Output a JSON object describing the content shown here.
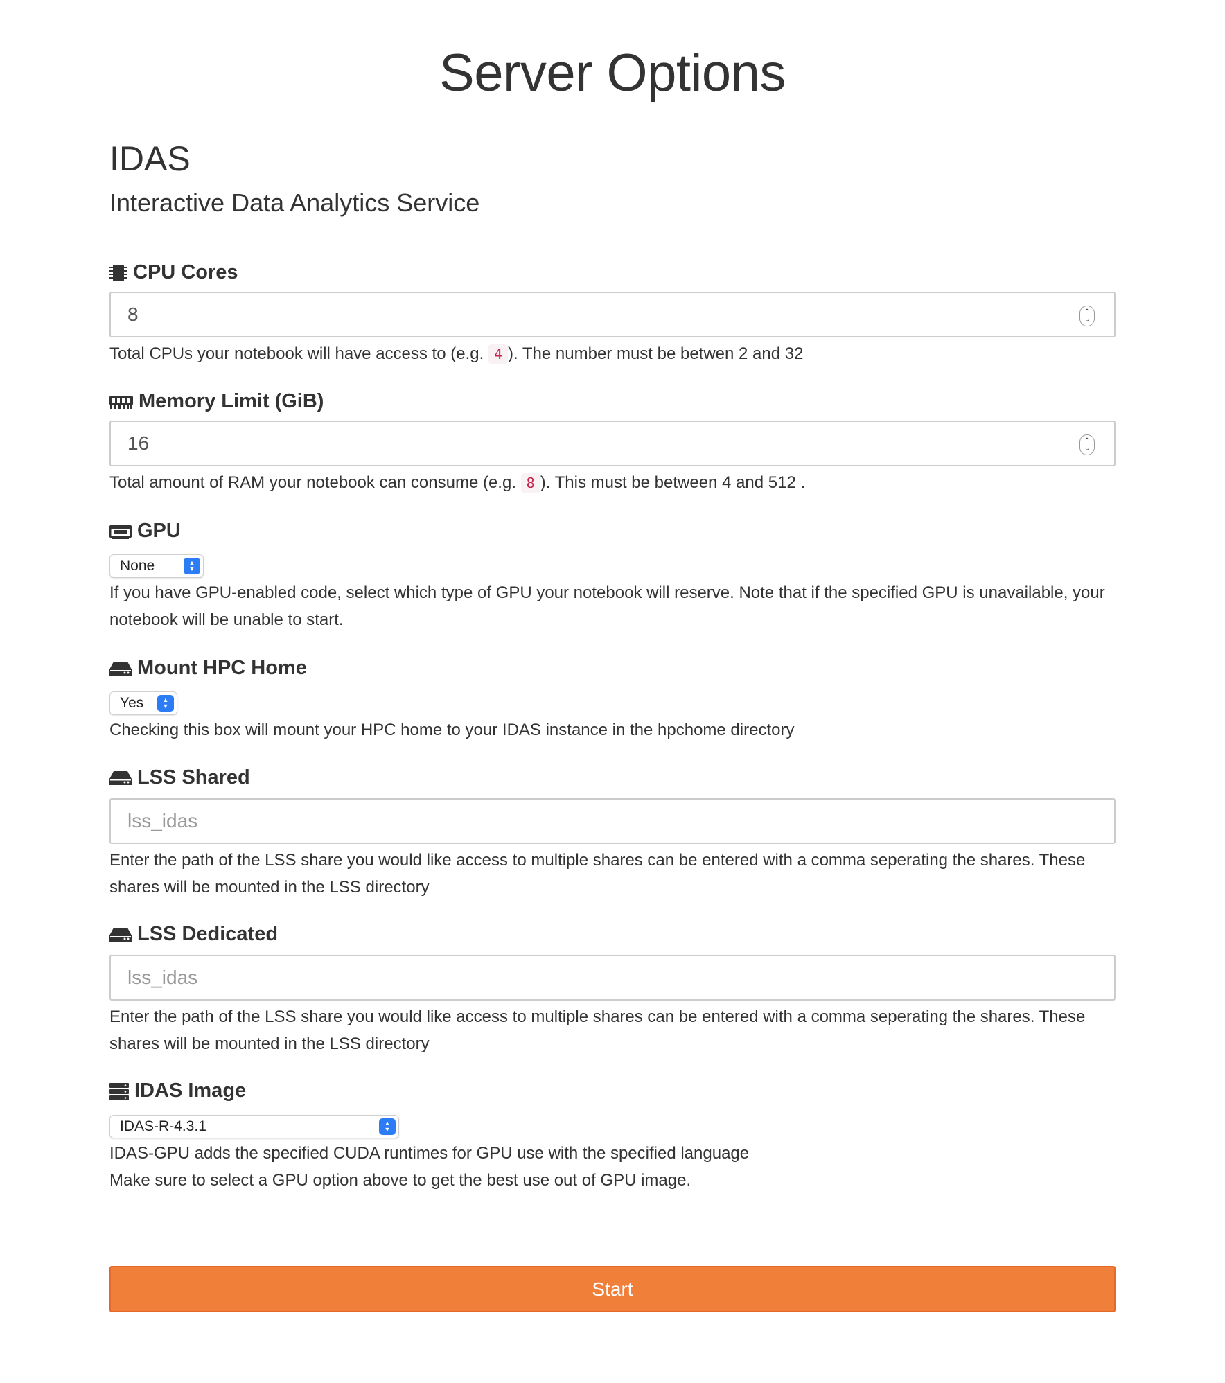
{
  "page": {
    "title": "Server Options"
  },
  "app": {
    "name": "IDAS",
    "subtitle": "Interactive Data Analytics Service"
  },
  "cpu": {
    "icon": "cpu-chip-icon",
    "label": "CPU Cores",
    "value": "8",
    "help_before": "Total CPUs your notebook will have access to (e.g.",
    "help_code": "4",
    "help_after": "). The number must be betwen 2 and 32"
  },
  "memory": {
    "icon": "memory-icon",
    "label": "Memory Limit (GiB)",
    "value": "16",
    "help_before": "Total amount of RAM your notebook can consume (e.g.",
    "help_code": "8",
    "help_after": "). This must be between 4 and 512 ."
  },
  "gpu": {
    "icon": "gpu-card-icon",
    "label": "GPU",
    "selected": "None",
    "help": "If you have GPU-enabled code, select which type of GPU your notebook will reserve. Note that if the specified GPU is unavailable, your notebook will be unable to start."
  },
  "hpc_home": {
    "icon": "hard-drive-icon",
    "label": "Mount HPC Home",
    "selected": "Yes",
    "help": "Checking this box will mount your HPC home to your IDAS instance in the hpchome directory"
  },
  "lss_shared": {
    "icon": "hard-drive-icon",
    "label": "LSS Shared",
    "placeholder": "lss_idas",
    "help": "Enter the path of the LSS share you would like access to multiple shares can be entered with a comma seperating the shares. These shares will be mounted in the LSS directory"
  },
  "lss_dedicated": {
    "icon": "hard-drive-icon",
    "label": "LSS Dedicated",
    "placeholder": "lss_idas",
    "help": "Enter the path of the LSS share you would like access to multiple shares can be entered with a comma seperating the shares. These shares will be mounted in the LSS directory"
  },
  "image": {
    "icon": "server-stack-icon",
    "label": "IDAS Image",
    "selected": "IDAS-R-4.3.1",
    "help_line1": "IDAS-GPU adds the specified CUDA runtimes for GPU use with the specified language",
    "help_line2": "Make sure to select a GPU option above to get the best use out of GPU image."
  },
  "actions": {
    "start_label": "Start"
  },
  "colors": {
    "accent": "#f07f39",
    "select_arrow": "#2b7cf5",
    "code_text": "#c7254e"
  }
}
